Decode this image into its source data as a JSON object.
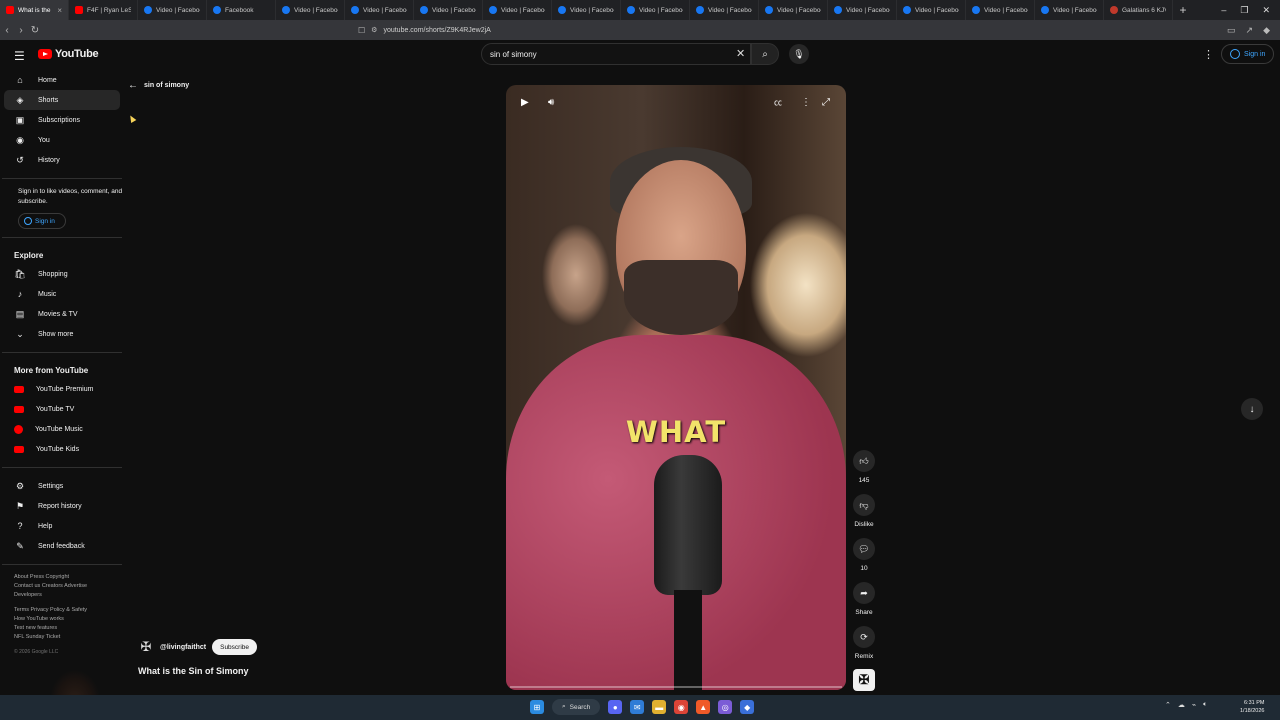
{
  "browser": {
    "tabs": [
      {
        "label": "What is the",
        "icon": "youtube-icon",
        "active": true
      },
      {
        "label": "F4F | Ryan LeStr",
        "icon": "youtube-icon"
      },
      {
        "label": "Video | Facebook",
        "icon": "facebook-icon"
      },
      {
        "label": "Facebook",
        "icon": "facebook-icon"
      },
      {
        "label": "Video | Faceboo",
        "icon": "facebook-icon"
      },
      {
        "label": "Video | Faceboo",
        "icon": "facebook-icon"
      },
      {
        "label": "Video | Faceboo",
        "icon": "facebook-icon"
      },
      {
        "label": "Video | Faceboo",
        "icon": "facebook-icon"
      },
      {
        "label": "Video | Faceboo",
        "icon": "facebook-icon"
      },
      {
        "label": "Video | Faceboo",
        "icon": "facebook-icon"
      },
      {
        "label": "Video | Faceboo",
        "icon": "facebook-icon"
      },
      {
        "label": "Video | Faceboo",
        "icon": "facebook-icon"
      },
      {
        "label": "Video | Faceboo",
        "icon": "facebook-icon"
      },
      {
        "label": "Video | Faceboo",
        "icon": "facebook-icon"
      },
      {
        "label": "Video | Faceboo",
        "icon": "facebook-icon"
      },
      {
        "label": "Video | Faceboo",
        "icon": "facebook-icon"
      },
      {
        "label": "Galatians 6 KJV",
        "icon": "bible-icon"
      }
    ],
    "url": "youtube.com/shorts/Z9K4RJew2jA"
  },
  "youtube": {
    "logo_text": "YouTube",
    "search_value": "sin of simony",
    "signin_label": "Sign in"
  },
  "sidebar": {
    "main": [
      {
        "label": "Home",
        "icon": "home-icon"
      },
      {
        "label": "Shorts",
        "icon": "shorts-icon",
        "active": true
      },
      {
        "label": "Subscriptions",
        "icon": "subscriptions-icon"
      },
      {
        "label": "You",
        "icon": "you-icon"
      },
      {
        "label": "History",
        "icon": "history-icon"
      }
    ],
    "signin_note": "Sign in to like videos, comment, and subscribe.",
    "signin_label": "Sign in",
    "explore_heading": "Explore",
    "explore": [
      {
        "label": "Shopping",
        "icon": "shopping-icon"
      },
      {
        "label": "Music",
        "icon": "music-icon"
      },
      {
        "label": "Movies & TV",
        "icon": "movies-icon"
      },
      {
        "label": "Show more",
        "icon": "chevron-down-icon"
      }
    ],
    "more_heading": "More from YouTube",
    "more": [
      {
        "label": "YouTube Premium"
      },
      {
        "label": "YouTube TV"
      },
      {
        "label": "YouTube Music"
      },
      {
        "label": "YouTube Kids"
      }
    ],
    "settings": [
      {
        "label": "Settings",
        "icon": "gear-icon"
      },
      {
        "label": "Report history",
        "icon": "flag-icon"
      },
      {
        "label": "Help",
        "icon": "help-icon"
      },
      {
        "label": "Send feedback",
        "icon": "feedback-icon"
      }
    ],
    "footer": {
      "line1": "About  Press  Copyright",
      "line2": "Contact us  Creators  Advertise",
      "line3": "Developers",
      "line4": "Terms  Privacy  Policy & Safety",
      "line5": "How YouTube works",
      "line6": "Test new features",
      "line7": "NFL Sunday Ticket",
      "copyright": "© 2026 Google LLC"
    }
  },
  "shorts": {
    "back_query": "sin of simony",
    "caption": "WHAT",
    "channel_handle": "@livingfaithct",
    "subscribe_label": "Subscribe",
    "title": "What is the Sin of Simony",
    "actions": {
      "like_count": "145",
      "dislike_label": "Dislike",
      "comment_count": "10",
      "share_label": "Share",
      "remix_label": "Remix"
    }
  },
  "taskbar": {
    "search_label": "Search",
    "time": "6:31 PM",
    "date": "1/18/2026"
  }
}
